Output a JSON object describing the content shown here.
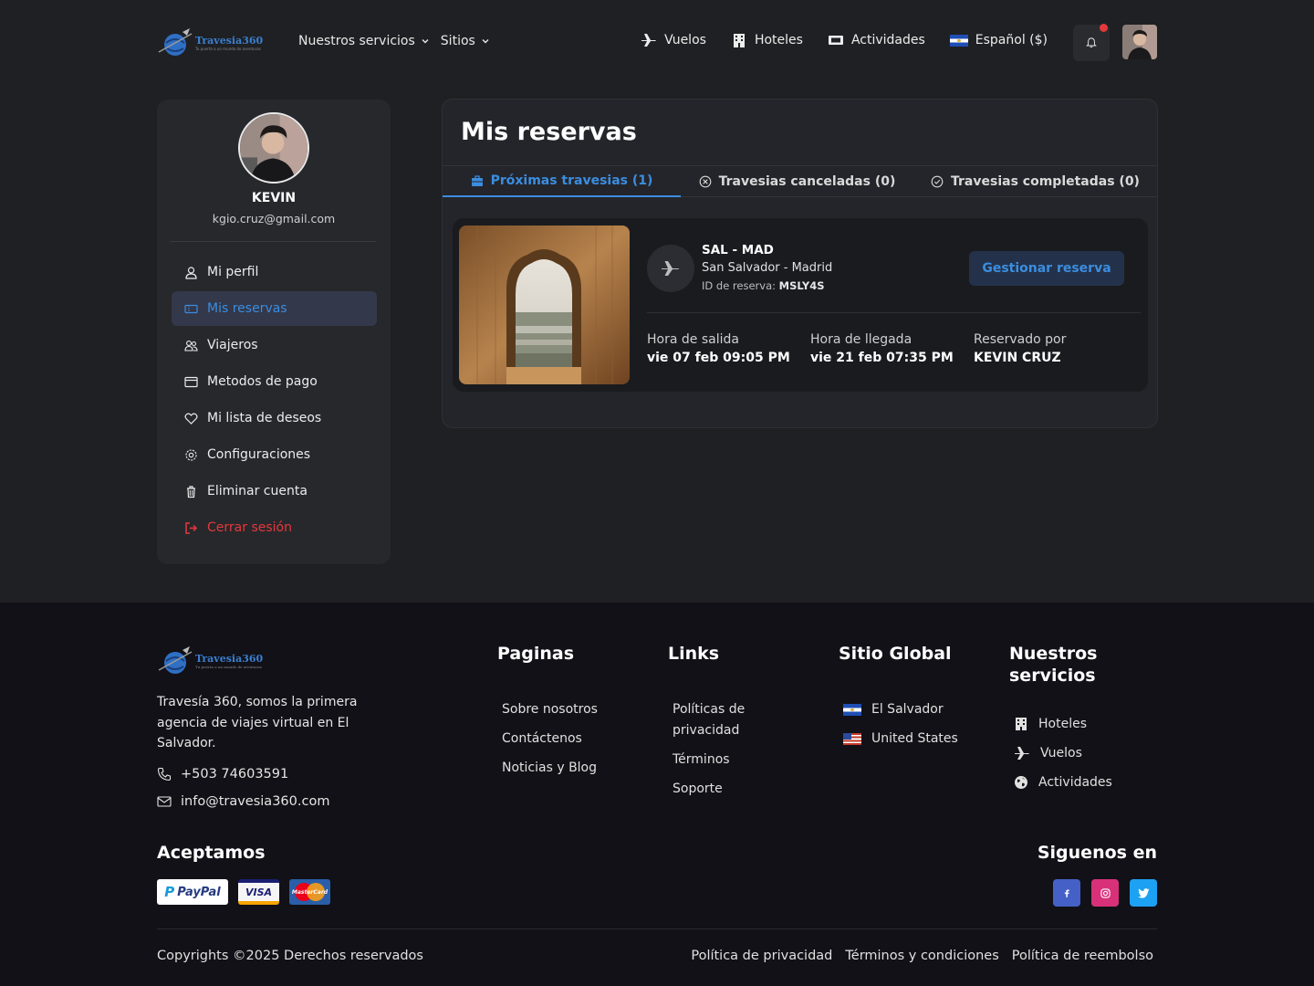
{
  "header": {
    "brand": "Travesia360",
    "tagline": "Tu puerta a un mundo de aventuras",
    "nav_left": [
      "Nuestros servicios",
      "Sitios"
    ],
    "nav_right": {
      "flights": "Vuelos",
      "hotels": "Hoteles",
      "activities": "Actividades",
      "language": "Español ($)"
    }
  },
  "sidebar": {
    "name": "KEVIN",
    "email": "kgio.cruz@gmail.com",
    "items": [
      {
        "label": "Mi perfil",
        "icon": "user-icon"
      },
      {
        "label": "Mis reservas",
        "icon": "ticket-icon",
        "active": true
      },
      {
        "label": "Viajeros",
        "icon": "users-icon"
      },
      {
        "label": "Metodos de pago",
        "icon": "credit-card-icon"
      },
      {
        "label": "Mi lista de deseos",
        "icon": "heart-icon"
      },
      {
        "label": "Configuraciones",
        "icon": "gear-icon"
      },
      {
        "label": "Eliminar cuenta",
        "icon": "trash-icon"
      },
      {
        "label": "Cerrar sesión",
        "icon": "logout-icon"
      }
    ]
  },
  "main": {
    "title": "Mis reservas",
    "tabs": [
      {
        "label": "Próximas travesias (1)",
        "active": true
      },
      {
        "label": "Travesias canceladas (0)"
      },
      {
        "label": "Travesias completadas (0)"
      }
    ],
    "booking": {
      "route": "SAL - MAD",
      "cities": "San Salvador - Madrid",
      "reservation_label": "ID de reserva:",
      "reservation_id": "MSLY4S",
      "manage_label": "Gestionar reserva",
      "departure_label": "Hora de salida",
      "departure_value": "vie 07 feb 09:05 PM",
      "arrival_label": "Hora de llegada",
      "arrival_value": "vie 21 feb 07:35 PM",
      "booked_by_label": "Reservado por",
      "booked_by_value": "KEVIN CRUZ"
    }
  },
  "footer": {
    "about": "Travesía 360, somos la primera agencia de viajes virtual en El Salvador.",
    "phone": "+503 74603591",
    "email": "info@travesia360.com",
    "pages_title": "Paginas",
    "pages": [
      "Sobre nosotros",
      "Contáctenos",
      "Noticias y Blog"
    ],
    "links_title": "Links",
    "links": [
      "Políticas de privacidad",
      "Términos",
      "Soporte"
    ],
    "global_title": "Sitio Global",
    "global": [
      "El Salvador",
      "United States"
    ],
    "services_title": "Nuestros servicios",
    "services": [
      "Hoteles",
      "Vuelos",
      "Actividades"
    ],
    "accept_title": "Aceptamos",
    "cards": [
      "PayPal",
      "VISA",
      "MasterCard"
    ],
    "follow_title": "Siguenos en",
    "copyright": "Copyrights ©2025 Derechos reservados",
    "legal": [
      "Política de privacidad",
      "Términos y condiciones",
      "Política de reembolso"
    ]
  },
  "colors": {
    "background": "#1f2023",
    "accent": "#3b8de0",
    "danger": "#e5383b",
    "footer_bg": "#111117"
  }
}
